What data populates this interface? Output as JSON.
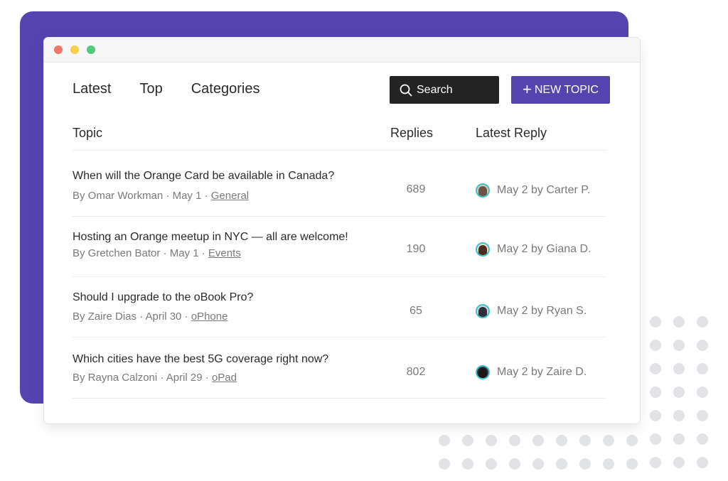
{
  "colors": {
    "accent": "#5544b0",
    "search_bg": "#232323",
    "avatar_ring": "#3fc3c6"
  },
  "nav": {
    "tabs": [
      "Latest",
      "Top",
      "Categories"
    ]
  },
  "toolbar": {
    "search_label": "Search",
    "search_icon": "search-icon",
    "new_topic_label": "NEW TOPIC",
    "new_topic_icon": "plus-icon"
  },
  "table": {
    "headers": {
      "topic": "Topic",
      "replies": "Replies",
      "latest": "Latest Reply"
    },
    "rows": [
      {
        "title": "When will the Orange Card be available in Canada?",
        "author_meta": "By Omar Workman · May 1 · ",
        "category": "General",
        "replies": "689",
        "latest": "May 2 by Carter P."
      },
      {
        "title": "Hosting an Orange meetup in NYC — all are welcome!",
        "author_meta": "By Gretchen Bator · May 1 · ",
        "category": "Events",
        "replies": "190",
        "latest": "May 2 by Giana D."
      },
      {
        "title": "Should I upgrade to the oBook Pro?",
        "author_meta": "By Zaire Dias · April 30 · ",
        "category": "oPhone",
        "replies": "65",
        "latest": "May 2 by Ryan S."
      },
      {
        "title": "Which cities have the best 5G coverage right now?",
        "author_meta": "By Rayna Calzoni · April 29 · ",
        "category": "oPad",
        "replies": "802",
        "latest": "May 2 by Zaire D."
      }
    ]
  }
}
